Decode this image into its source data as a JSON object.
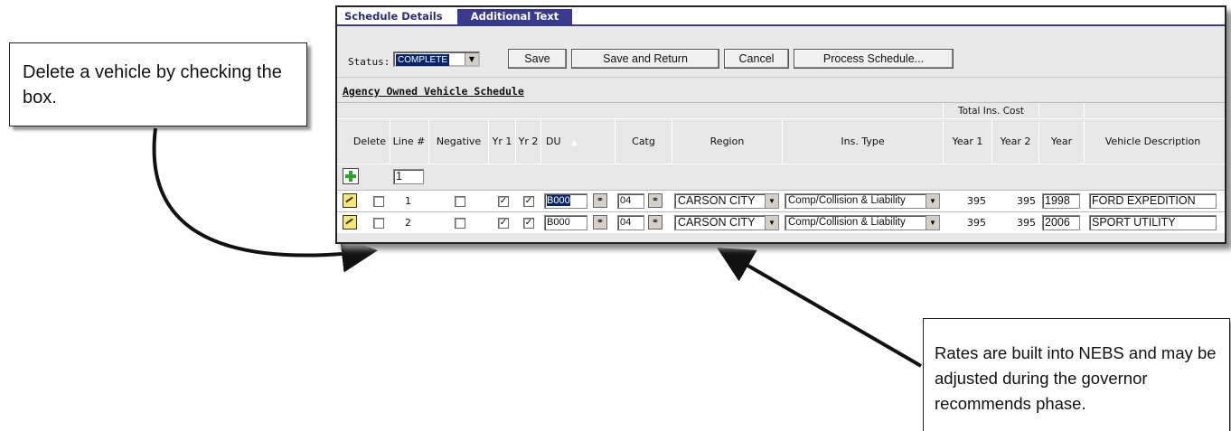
{
  "callouts": {
    "left": "Delete a vehicle by checking the box.",
    "right": "Rates are built into NEBS and may be adjusted during the governor recommends phase."
  },
  "tabs": [
    "Schedule Details",
    "Additional Text"
  ],
  "status": {
    "label": "Status:",
    "value": "COMPLETE"
  },
  "buttons": {
    "save": "Save",
    "save_return": "Save and Return",
    "cancel": "Cancel",
    "process": "Process Schedule..."
  },
  "section_title": "Agency Owned Vehicle Schedule",
  "table": {
    "group_header": "Total Ins. Cost",
    "headers": {
      "delete": "Delete",
      "line": "Line #",
      "negative": "Negative",
      "yr1": "Yr 1",
      "yr2": "Yr 2",
      "du": "DU",
      "catg": "Catg",
      "region": "Region",
      "ins_type": "Ins. Type",
      "year1": "Year 1",
      "year2": "Year 2",
      "year": "Year",
      "desc": "Vehicle Description"
    },
    "new_line_value": "1",
    "rows": [
      {
        "line": "1",
        "yr1": true,
        "yr2": true,
        "du": "B000",
        "catg": "04",
        "region": "CARSON CITY",
        "ins_type": "Comp/Collision & Liability",
        "year1_cost": "395",
        "year2_cost": "395",
        "year": "1998",
        "desc": "FORD EXPEDITION"
      },
      {
        "line": "2",
        "yr1": true,
        "yr2": true,
        "du": "B000",
        "catg": "04",
        "region": "CARSON CITY",
        "ins_type": "Comp/Collision & Liability",
        "year1_cost": "395",
        "year2_cost": "395",
        "year": "2006",
        "desc": "SPORT UTILITY"
      }
    ]
  }
}
